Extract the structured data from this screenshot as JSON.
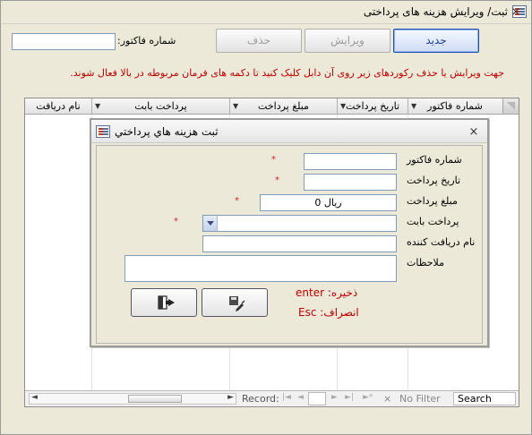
{
  "window": {
    "title": "ثبت/ ویرایش هزینه های پرداختی",
    "close_glyph": "×"
  },
  "filter": {
    "label": "شماره فاکتور:",
    "value": ""
  },
  "toolbar": {
    "new_label": "جدید",
    "edit_label": "ویرایش",
    "delete_label": "حذف"
  },
  "info_text": "جهت ویرایش یا حذف رکوردهای زیر روی  آن دابل کلیک کنید تا دکمه های فرمان مربوطه در بالا فعال شوند.",
  "grid": {
    "columns": [
      "شماره فاکتور",
      "تاریخ پرداخت",
      "مبلغ پرداخت",
      "پرداخت بابت",
      "نام دریافت"
    ],
    "dropdown_glyph": "▼"
  },
  "navbar": {
    "record_label": "Record:",
    "first": "|◄",
    "prev": "◄",
    "next": "►",
    "last": "►|",
    "new": "►*",
    "no_filter_label": "No Filter",
    "search_label": "Search",
    "scroll_left": "◄",
    "scroll_right": "►"
  },
  "popup": {
    "title": "ثبت هزینه هاي پرداختي",
    "close_glyph": "×",
    "required_mark": "*",
    "fields": {
      "invoice_label": "شماره فاکتور",
      "invoice_value": "",
      "date_label": "تاریخ پرداخت",
      "date_value": "",
      "amount_label": "مبلغ پرداخت",
      "amount_value": "ريال 0",
      "reason_label": "پرداخت بابت",
      "reason_value": "",
      "receiver_label": "نام دریافت کننده",
      "receiver_value": "",
      "notes_label": "ملاحظات",
      "notes_value": ""
    },
    "save_hint": "ذخیره: enter",
    "cancel_hint": "انصراف: Esc"
  },
  "icons": {
    "form": "form-icon",
    "save": "save-icon",
    "exit": "exit-door-icon"
  }
}
